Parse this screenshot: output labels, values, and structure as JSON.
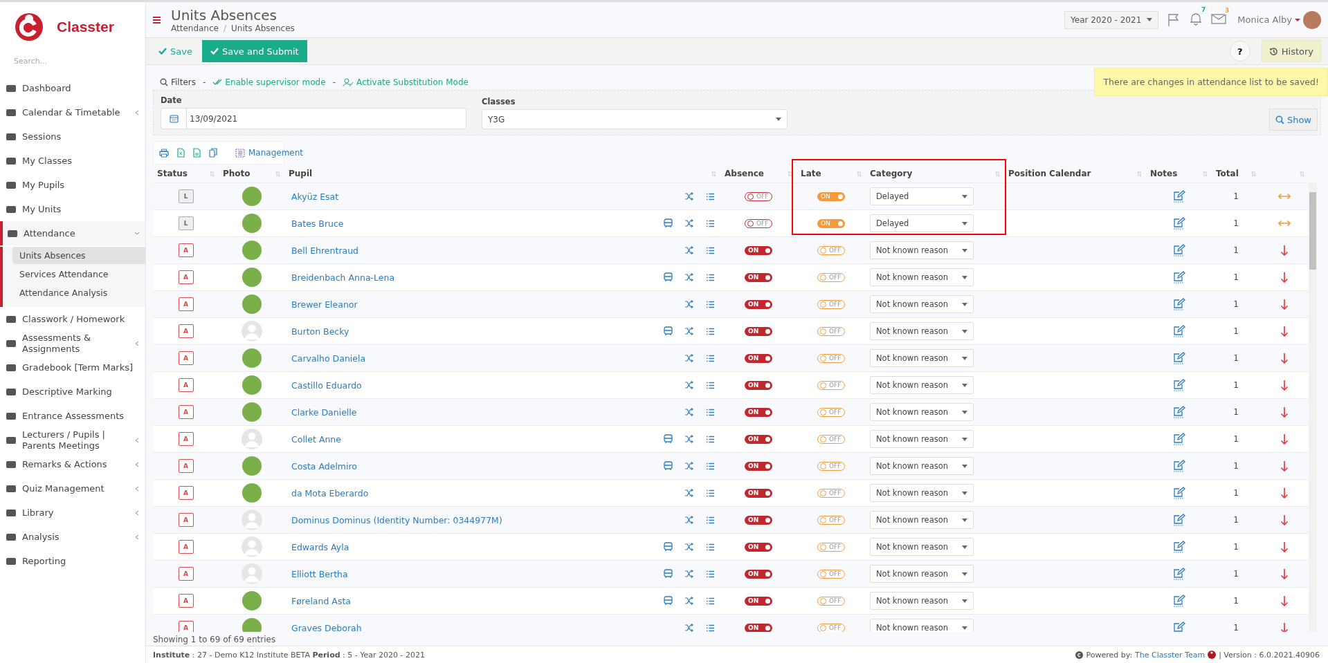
{
  "brand": {
    "name": "Classter"
  },
  "sidebar": {
    "search_placeholder": "Search...",
    "items": [
      {
        "label": "Dashboard",
        "has_submenu": false,
        "expanded": false
      },
      {
        "label": "Calendar & Timetable",
        "has_submenu": true,
        "expanded": false
      },
      {
        "label": "Sessions",
        "has_submenu": false,
        "expanded": false
      },
      {
        "label": "My Classes",
        "has_submenu": false,
        "expanded": false
      },
      {
        "label": "My Pupils",
        "has_submenu": false,
        "expanded": false
      },
      {
        "label": "My Units",
        "has_submenu": false,
        "expanded": false
      },
      {
        "label": "Attendance",
        "has_submenu": true,
        "expanded": true,
        "children": [
          {
            "label": "Units Absences",
            "selected": true
          },
          {
            "label": "Services Attendance",
            "selected": false
          },
          {
            "label": "Attendance Analysis",
            "selected": false
          }
        ]
      },
      {
        "label": "Classwork / Homework",
        "has_submenu": false,
        "expanded": false
      },
      {
        "label": "Assessments & Assignments",
        "has_submenu": true,
        "expanded": false
      },
      {
        "label": "Gradebook [Term Marks]",
        "has_submenu": false,
        "expanded": false
      },
      {
        "label": "Descriptive Marking",
        "has_submenu": false,
        "expanded": false
      },
      {
        "label": "Entrance Assessments",
        "has_submenu": false,
        "expanded": false
      },
      {
        "label": "Lecturers / Pupils | Parents Meetings",
        "has_submenu": true,
        "expanded": false
      },
      {
        "label": "Remarks & Actions",
        "has_submenu": true,
        "expanded": false
      },
      {
        "label": "Quiz Management",
        "has_submenu": true,
        "expanded": false
      },
      {
        "label": "Library",
        "has_submenu": true,
        "expanded": false
      },
      {
        "label": "Analysis",
        "has_submenu": true,
        "expanded": false
      },
      {
        "label": "Reporting",
        "has_submenu": false,
        "expanded": false
      }
    ]
  },
  "header": {
    "title": "Units Absences",
    "breadcrumb": [
      "Attendance",
      "Units Absences"
    ],
    "breadcrumb_separator": "/",
    "year": "Year 2020 - 2021",
    "notifications": "7",
    "messages": "3",
    "user": "Monica Alby"
  },
  "toolbar": {
    "save": "Save",
    "save_submit": "Save and Submit",
    "help": "?",
    "history": "History",
    "notice": "There are changes in attendance list to be saved!"
  },
  "filters": {
    "title": "Filters",
    "separator": "-",
    "supervisor": "Enable supervisor mode",
    "substitution": "Activate Substitution Mode",
    "date_label": "Date",
    "date": "13/09/2021",
    "classes_label": "Classes",
    "classes": "Y3G",
    "show": "Show"
  },
  "table_tools": {
    "management": "Management"
  },
  "table": {
    "columns": [
      "Status",
      "Photo",
      "Pupil",
      "Absence",
      "Late",
      "Category",
      "Position Calendar",
      "Notes",
      "Total"
    ],
    "rows": [
      {
        "status": "L",
        "has_photo": true,
        "name": "Akyüz Esat",
        "bus": false,
        "absence": false,
        "absence_label": "OFF",
        "late": true,
        "late_label": "ON",
        "category": "Delayed",
        "total": "1"
      },
      {
        "status": "L",
        "has_photo": true,
        "name": "Bates Bruce",
        "bus": true,
        "absence": false,
        "absence_label": "OFF",
        "late": true,
        "late_label": "ON",
        "category": "Delayed",
        "total": "1"
      },
      {
        "status": "A",
        "has_photo": true,
        "name": "Bell Ehrentraud",
        "bus": false,
        "absence": true,
        "absence_label": "ON",
        "late": false,
        "late_label": "OFF",
        "category": "Not known reason",
        "total": "1"
      },
      {
        "status": "A",
        "has_photo": true,
        "name": "Breidenbach Anna-Lena",
        "bus": true,
        "absence": true,
        "absence_label": "ON",
        "late": false,
        "late_label": "OFF",
        "category": "Not known reason",
        "total": "1"
      },
      {
        "status": "A",
        "has_photo": true,
        "name": "Brewer Eleanor",
        "bus": false,
        "absence": true,
        "absence_label": "ON",
        "late": false,
        "late_label": "OFF",
        "category": "Not known reason",
        "total": "1"
      },
      {
        "status": "A",
        "has_photo": false,
        "name": "Burton Becky",
        "bus": true,
        "absence": true,
        "absence_label": "ON",
        "late": false,
        "late_label": "OFF",
        "category": "Not known reason",
        "total": "1"
      },
      {
        "status": "A",
        "has_photo": true,
        "name": "Carvalho Daniela",
        "bus": false,
        "absence": true,
        "absence_label": "ON",
        "late": false,
        "late_label": "OFF",
        "category": "Not known reason",
        "total": "1"
      },
      {
        "status": "A",
        "has_photo": true,
        "name": "Castillo Eduardo",
        "bus": false,
        "absence": true,
        "absence_label": "ON",
        "late": false,
        "late_label": "OFF",
        "category": "Not known reason",
        "total": "1"
      },
      {
        "status": "A",
        "has_photo": true,
        "name": "Clarke Danielle",
        "bus": false,
        "absence": true,
        "absence_label": "ON",
        "late": false,
        "late_label": "OFF",
        "category": "Not known reason",
        "total": "1"
      },
      {
        "status": "A",
        "has_photo": false,
        "name": "Collet Anne",
        "bus": true,
        "absence": true,
        "absence_label": "ON",
        "late": false,
        "late_label": "OFF",
        "category": "Not known reason",
        "total": "1"
      },
      {
        "status": "A",
        "has_photo": true,
        "name": "Costa Adelmiro",
        "bus": true,
        "absence": true,
        "absence_label": "ON",
        "late": false,
        "late_label": "OFF",
        "category": "Not known reason",
        "total": "1"
      },
      {
        "status": "A",
        "has_photo": true,
        "name": "da Mota Eberardo",
        "bus": false,
        "absence": true,
        "absence_label": "ON",
        "late": false,
        "late_label": "OFF",
        "category": "Not known reason",
        "total": "1"
      },
      {
        "status": "A",
        "has_photo": false,
        "name": "Dominus Dominus (Identity Number: 0344977M)",
        "bus": false,
        "absence": true,
        "absence_label": "ON",
        "late": false,
        "late_label": "OFF",
        "category": "Not known reason",
        "total": "1"
      },
      {
        "status": "A",
        "has_photo": false,
        "name": "Edwards Ayla",
        "bus": true,
        "absence": true,
        "absence_label": "ON",
        "late": false,
        "late_label": "OFF",
        "category": "Not known reason",
        "total": "1"
      },
      {
        "status": "A",
        "has_photo": false,
        "name": "Elliott Bertha",
        "bus": true,
        "absence": true,
        "absence_label": "ON",
        "late": false,
        "late_label": "OFF",
        "category": "Not known reason",
        "total": "1"
      },
      {
        "status": "A",
        "has_photo": true,
        "name": "Føreland Asta",
        "bus": true,
        "absence": true,
        "absence_label": "ON",
        "late": false,
        "late_label": "OFF",
        "category": "Not known reason",
        "total": "1"
      },
      {
        "status": "A",
        "has_photo": true,
        "name": "Graves Deborah",
        "bus": false,
        "absence": true,
        "absence_label": "ON",
        "late": false,
        "late_label": "OFF",
        "category": "Not known reason",
        "total": "1"
      }
    ]
  },
  "entries": "Showing 1 to 69 of 69 entries",
  "footer": {
    "info": "**Institute** : 27 - Demo K12 Institute BETA **Period** : 5 - Year 2020 - 2021",
    "powered": "Powered by:",
    "team": "The Classter Team",
    "version": "| Version : 6.0.2021.40906"
  }
}
